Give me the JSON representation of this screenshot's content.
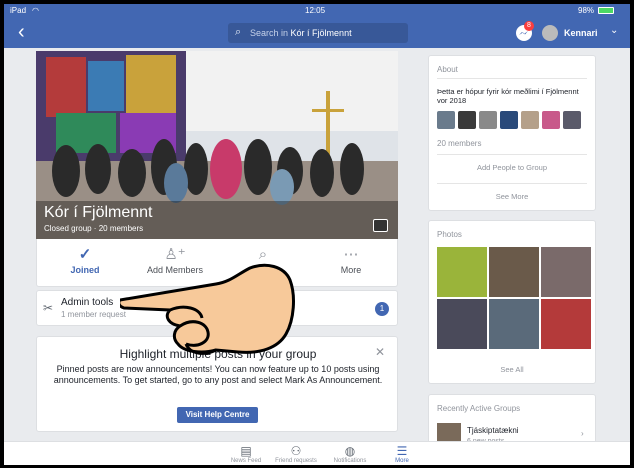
{
  "status_bar": {
    "device": "iPad",
    "time": "12:05",
    "battery": "98%"
  },
  "nav": {
    "search_placeholder": "Search in",
    "search_group": "Kór í Fjölmennt",
    "messenger_badge": "8",
    "user_name": "Kennari"
  },
  "group": {
    "name": "Kór í Fjölmennt",
    "subtitle": "Closed group · 20 members"
  },
  "actions": [
    {
      "label": "Joined",
      "icon": "check-circle-icon"
    },
    {
      "label": "Add Members",
      "icon": "add-person-icon"
    },
    {
      "label": "Search",
      "icon": "search-icon"
    },
    {
      "label": "More",
      "icon": "more-icon"
    }
  ],
  "admin_tools": {
    "title": "Admin tools",
    "subtitle": "1 member request",
    "count": "1"
  },
  "pinned_notice": {
    "heading": "Highlight multiple posts in your group",
    "body": "Pinned posts are now announcements! You can now feature up to 10 posts using announcements. To get started, go to any post and select Mark As Announcement.",
    "button": "Visit Help Centre"
  },
  "about": {
    "title": "About",
    "description": "Þetta er hópur fyrir kór meðlimi í Fjölmennt vor 2018",
    "members_count": "20 members",
    "add_people": "Add People to Group",
    "see_more": "See More"
  },
  "photos": {
    "title": "Photos",
    "see_all": "See All"
  },
  "recent_groups": {
    "title": "Recently Active Groups",
    "items": [
      {
        "name": "Tjáskiptatækni",
        "subtitle": "6 new posts"
      }
    ]
  },
  "tab_bar": [
    {
      "label": "News Feed",
      "icon": "news-feed-icon"
    },
    {
      "label": "Friend requests",
      "icon": "friends-icon"
    },
    {
      "label": "Notifications",
      "icon": "globe-icon"
    },
    {
      "label": "More",
      "icon": "menu-icon"
    }
  ],
  "colors": {
    "brand": "#4267b2",
    "badge": "#fa3e3e",
    "background": "#e9ebee"
  }
}
